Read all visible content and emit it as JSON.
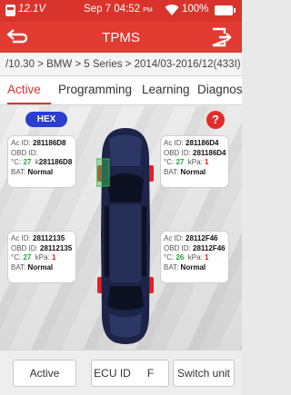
{
  "status_bar": {
    "battery_voltage": "12.1V",
    "time": "Sep 7 04:52",
    "ampm": "PM",
    "battery_percent": "100%"
  },
  "title_bar": {
    "title": "TPMS"
  },
  "breadcrumb": "/10.30 > BMW > 5 Series > 2014/03-2016/12(433I)",
  "tabs": [
    {
      "label": "Active",
      "active": true
    },
    {
      "label": "Programming",
      "active": false
    },
    {
      "label": "Learning",
      "active": false
    },
    {
      "label": "Diagnos",
      "active": false
    }
  ],
  "controls": {
    "hex_label": "HEX",
    "help_label": "?"
  },
  "tires": {
    "front_left": {
      "ac_id_label": "Ac ID:",
      "ac_id": "281186D8",
      "obd_label": "OBD ID:",
      "obd_id": "",
      "temp_label": "°C:",
      "temp": "27",
      "kpa_label": "k",
      "kpa_overlap": "281186D8",
      "bat_label": "BAT:",
      "bat": "Normal"
    },
    "front_right": {
      "ac_id_label": "Ac ID:",
      "ac_id": "281186D4",
      "obd_label": "OBD ID:",
      "obd_id": "281186D4",
      "temp_label": "°C:",
      "temp": "27",
      "kpa_label": "kPa:",
      "kpa": "1",
      "bat_label": "BAT:",
      "bat": "Normal"
    },
    "rear_left": {
      "ac_id_label": "Ac ID:",
      "ac_id": "28112135",
      "obd_label": "OBD ID:",
      "obd_id": "28112135",
      "temp_label": "°C:",
      "temp": "27",
      "kpa_label": "kPa:",
      "kpa": "1",
      "bat_label": "BAT:",
      "bat": "Normal"
    },
    "rear_right": {
      "ac_id_label": "Ac ID:",
      "ac_id": "28112F46",
      "obd_label": "OBD ID:",
      "obd_id": "28112F46",
      "temp_label": "°C:",
      "temp": "26",
      "kpa_label": "kPa:",
      "kpa": "1",
      "bat_label": "BAT:",
      "bat": "Normal"
    }
  },
  "bottom_buttons": {
    "active": "Active",
    "ecu_id": "ECU ID",
    "f": "F",
    "switch_unit": "Switch unit"
  },
  "colors": {
    "accent": "#d9342b",
    "hex_button": "#2a3ecf",
    "value_green": "#20a63a",
    "value_red": "#e02020",
    "car_body": "#1c2447"
  }
}
